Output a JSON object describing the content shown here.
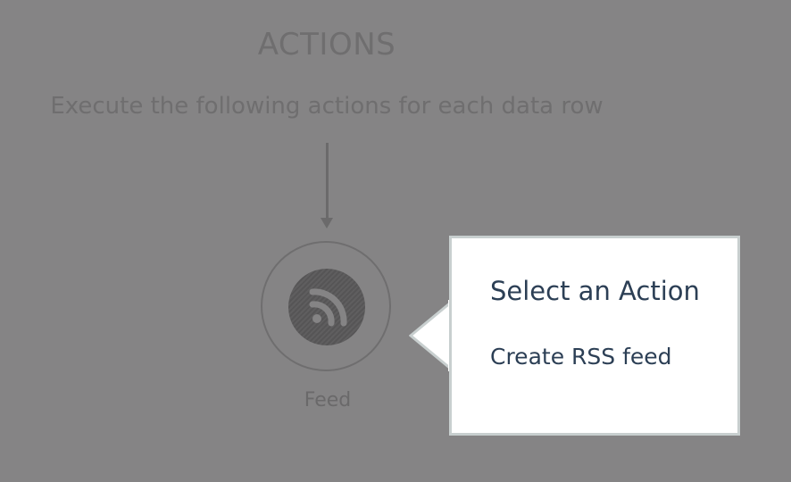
{
  "section": {
    "title": "ACTIONS",
    "subtitle": "Execute the following actions for each data row"
  },
  "node": {
    "icon": "rss-icon",
    "label": "Feed"
  },
  "popover": {
    "title": "Select an Action",
    "items": [
      {
        "label": "Create RSS feed"
      }
    ]
  },
  "colors": {
    "overlay_background": "#858485",
    "popover_background": "#ffffff",
    "popover_text": "#2c3f55"
  }
}
